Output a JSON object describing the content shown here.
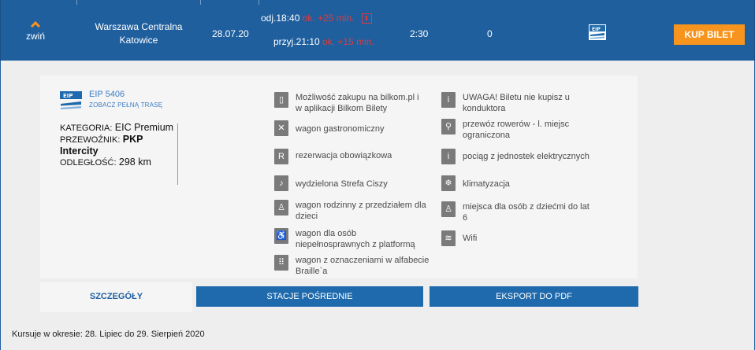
{
  "header": {
    "collapse_label": "zwiń",
    "from": "Warszawa Centralna",
    "to": "Katowice",
    "date": "28.07.20",
    "departure_label": "odj.18:40",
    "departure_delay": "ok. +25 min.",
    "arrival_label": "przyj.21:10",
    "arrival_delay": "ok. +15 min.",
    "duration": "2:30",
    "changes": "0",
    "carrier_icon": "eip-train-icon",
    "buy_label": "KUP BILET",
    "accent_color": "#1f5f9e",
    "buy_color": "#f7941d",
    "delay_color": "#e03a3a"
  },
  "details": {
    "train_number": "EIP 5406",
    "full_route_link": "ZOBACZ PEŁNĄ TRASĘ",
    "category_label": "KATEGORIA:",
    "category_value": "EIC Premium",
    "carrier_label": "PRZEWOŹNIK:",
    "carrier_value": "PKP Intercity",
    "distance_label": "ODLEGŁOŚĆ:",
    "distance_value": "298 km"
  },
  "features_left": [
    {
      "icon": "phone-icon",
      "text1": "Możliwość zakupu na bilkom.pl i",
      "text2": "w aplikacji Bilkom Bilety"
    },
    {
      "icon": "cutlery-icon",
      "text1": "wagon gastronomiczny",
      "text2": ""
    },
    {
      "icon": "reservation-icon",
      "text1": "rezerwacja obowiązkowa",
      "text2": ""
    },
    {
      "icon": "quiet-zone-icon",
      "text1": "wydzielona Strefa Ciszy",
      "text2": ""
    },
    {
      "icon": "family-icon",
      "text1": "wagon rodzinny z przedziałem dla",
      "text2": "dzieci"
    },
    {
      "icon": "wheelchair-icon",
      "text1": "wagon dla osób",
      "text2": "niepełnosprawnych z platformą"
    },
    {
      "icon": "braille-icon",
      "text1": "wagon z oznaczeniami w alfabecie",
      "text2": "Braille`a"
    }
  ],
  "features_right": [
    {
      "icon": "info-icon",
      "text1": "UWAGA! Biletu nie kupisz u",
      "text2": "konduktora"
    },
    {
      "icon": "bicycle-icon",
      "text1": "przewóz rowerów - l. miejsc",
      "text2": "ograniczona"
    },
    {
      "icon": "info-icon",
      "text1": "pociąg z jednostek elektrycznych",
      "text2": ""
    },
    {
      "icon": "snowflake-icon",
      "text1": "klimatyzacja",
      "text2": ""
    },
    {
      "icon": "child-seat-icon",
      "text1": "miejsca dla osób z dziećmi do lat",
      "text2": "6"
    },
    {
      "icon": "wifi-icon",
      "text1": "Wifi",
      "text2": ""
    }
  ],
  "tabs": [
    "SZCZEGÓŁY",
    "STACJE POŚREDNIE",
    "EKSPORT DO PDF"
  ],
  "footer": "Kursuje w okresie: 28. Lipiec do 29. Sierpień 2020"
}
